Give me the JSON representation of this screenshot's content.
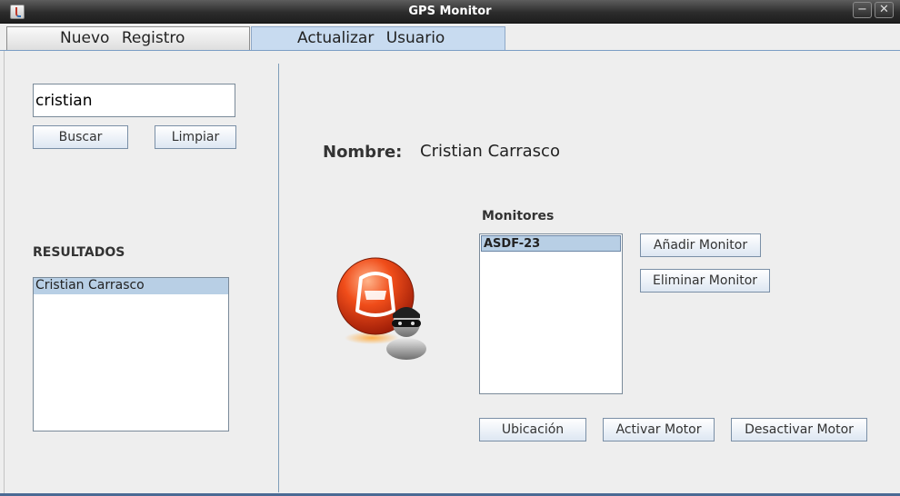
{
  "window": {
    "title": "GPS Monitor",
    "minimize_symbol": "−",
    "close_symbol": "✕"
  },
  "tabs": [
    {
      "label": "Nuevo Registro"
    },
    {
      "label": "Actualizar Usuario"
    }
  ],
  "search": {
    "value": "cristian",
    "buscar_label": "Buscar",
    "limpiar_label": "Limpiar"
  },
  "results": {
    "title": "RESULTADOS",
    "items": [
      "Cristian  Carrasco"
    ]
  },
  "details": {
    "nombre_label": "Nombre:",
    "nombre_value": "Cristian Carrasco"
  },
  "monitores": {
    "title": "Monitores",
    "items": [
      "ASDF-23"
    ],
    "add_label": "Añadir Monitor",
    "remove_label": "Eliminar Monitor"
  },
  "actions": {
    "ubicacion": "Ubicación",
    "activar": "Activar Motor",
    "desactivar": "Desactivar Motor"
  },
  "icons": {
    "app": "java-cup-icon",
    "car": "car-thief-icon"
  }
}
